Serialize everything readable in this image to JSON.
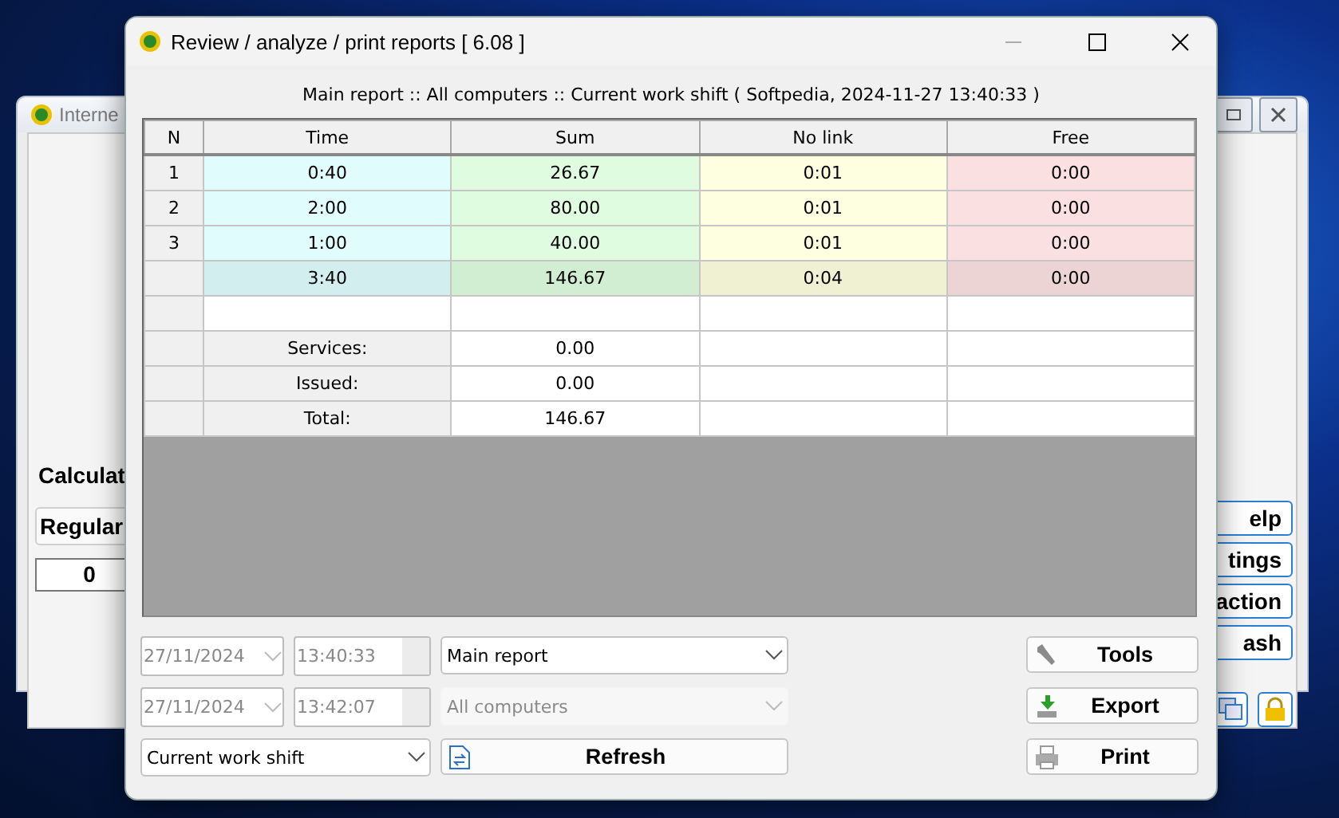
{
  "background_window": {
    "title": "Interne",
    "section_label": "Calculat",
    "mode_button": "Regular",
    "counter": "0",
    "side_buttons": [
      "elp",
      "tings",
      "action",
      "ash"
    ]
  },
  "window": {
    "title": "Review / analyze / print reports [ 6.08 ]"
  },
  "report_header": "Main report :: All computers :: Current work shift ( Softpedia, 2024-11-27 13:40:33 )",
  "table": {
    "columns": [
      "N",
      "Time",
      "Sum",
      "No link",
      "Free"
    ],
    "rows": [
      {
        "kind": "data",
        "cells": [
          "1",
          "0:40",
          "26.67",
          "0:01",
          "0:00"
        ]
      },
      {
        "kind": "data",
        "cells": [
          "2",
          "2:00",
          "80.00",
          "0:01",
          "0:00"
        ]
      },
      {
        "kind": "data",
        "cells": [
          "3",
          "1:00",
          "40.00",
          "0:01",
          "0:00"
        ]
      },
      {
        "kind": "subtotal",
        "cells": [
          "",
          "3:40",
          "146.67",
          "0:04",
          "0:00"
        ]
      },
      {
        "kind": "blank",
        "cells": []
      },
      {
        "kind": "summary",
        "cells": [
          "Services:",
          "0.00"
        ]
      },
      {
        "kind": "summary",
        "cells": [
          "Issued:",
          "0.00"
        ]
      },
      {
        "kind": "summary",
        "cells": [
          "Total:",
          "146.67"
        ]
      }
    ]
  },
  "period": {
    "from_date": "27/11/2024",
    "from_time": "13:40:33",
    "to_date": "27/11/2024",
    "to_time": "13:42:07",
    "range": "Current work shift"
  },
  "report_select": {
    "value": "Main report",
    "disabled": false
  },
  "computer_select": {
    "value": "All computers",
    "disabled": true
  },
  "refresh_button": "Refresh",
  "actions": [
    {
      "kind": "tools",
      "label": "Tools"
    },
    {
      "kind": "export",
      "label": "Export"
    },
    {
      "kind": "print",
      "label": "Print"
    }
  ]
}
